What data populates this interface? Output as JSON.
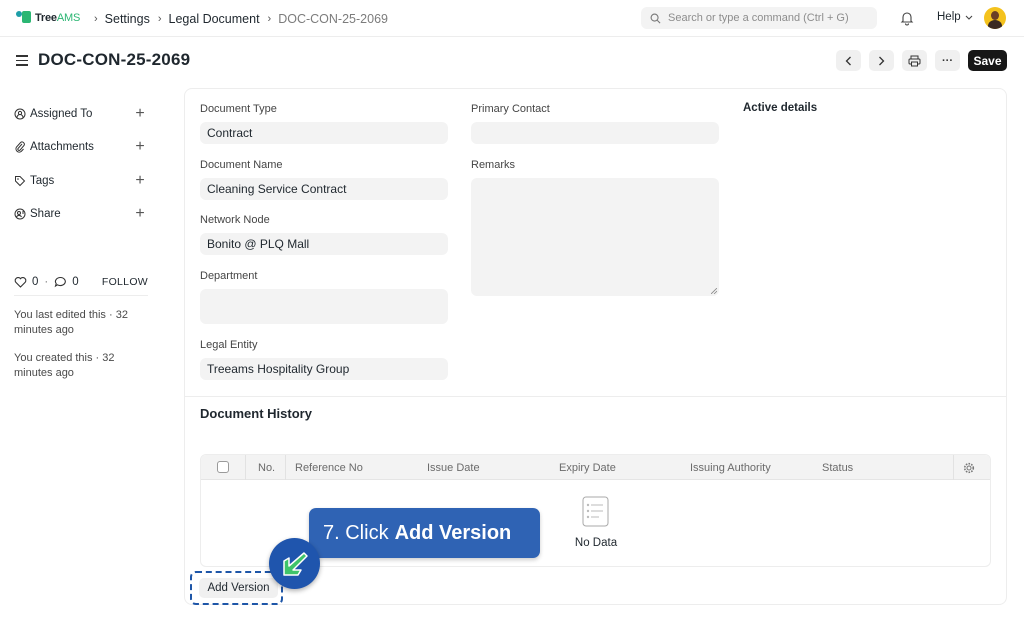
{
  "app": {
    "logo_name": "Tree",
    "logo_suffix": "AMS",
    "brand_color": "#2bb673"
  },
  "breadcrumb": [
    "Settings",
    "Legal Document",
    "DOC-CON-25-2069"
  ],
  "navbar": {
    "search_placeholder": "Search or type a command (Ctrl + G)",
    "help_label": "Help"
  },
  "page": {
    "title": "DOC-CON-25-2069",
    "save_label": "Save",
    "more_label": "···"
  },
  "sidebar": {
    "items": [
      {
        "label": "Assigned To",
        "icon": "assign-icon"
      },
      {
        "label": "Attachments",
        "icon": "paperclip-icon"
      },
      {
        "label": "Tags",
        "icon": "tag-icon"
      },
      {
        "label": "Share",
        "icon": "share-icon"
      }
    ],
    "likes": "0",
    "comments": "0",
    "follow_label": "FOLLOW",
    "activity": [
      "You last edited this · 32 minutes ago",
      "You created this · 32 minutes ago"
    ]
  },
  "form": {
    "document_type": {
      "label": "Document Type",
      "value": "Contract"
    },
    "document_name": {
      "label": "Document Name",
      "value": "Cleaning Service Contract"
    },
    "network_node": {
      "label": "Network Node",
      "value": "Bonito @ PLQ Mall"
    },
    "department": {
      "label": "Department",
      "value": ""
    },
    "legal_entity": {
      "label": "Legal Entity",
      "value": "Treeams Hospitality Group"
    },
    "primary_contact": {
      "label": "Primary Contact",
      "value": ""
    },
    "remarks": {
      "label": "Remarks",
      "value": ""
    },
    "active_details_title": "Active details"
  },
  "history": {
    "title": "Document History",
    "columns": [
      "No.",
      "Reference No",
      "Issue Date",
      "Expiry Date",
      "Issuing Authority",
      "Status"
    ],
    "empty_text": "No Data",
    "add_label": "Add Version"
  },
  "tutorial": {
    "step": "7. Click",
    "action": "Add Version",
    "color": "#2f63b4"
  }
}
